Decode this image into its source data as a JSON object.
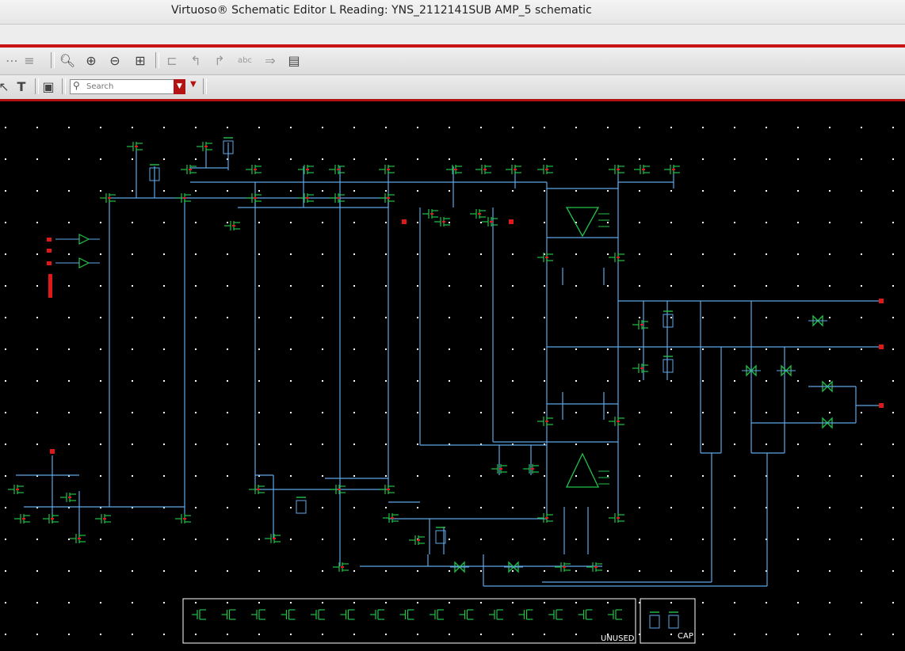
{
  "window": {
    "title": "Virtuoso® Schematic Editor L Reading: YNS_2112141SUB AMP_5 schematic"
  },
  "toolbar": {
    "icons": [
      "fit-icon",
      "zoom-in-icon",
      "zoom-out-icon",
      "zoom-area-icon",
      "zoom-select-icon",
      "hierarchy-icon",
      "descend-icon",
      "ascend-icon",
      "label-icon",
      "pin-icon",
      "properties-icon"
    ]
  },
  "search": {
    "placeholder": "Search"
  },
  "canvas": {
    "background": "#000000",
    "grid_color": "#ffffff",
    "wire_color": "#5ea7e8",
    "device_color": "#22c24a",
    "pin_color": "#e01818",
    "box_labels": {
      "unused": "UNUSED",
      "cap": "CAP"
    }
  }
}
